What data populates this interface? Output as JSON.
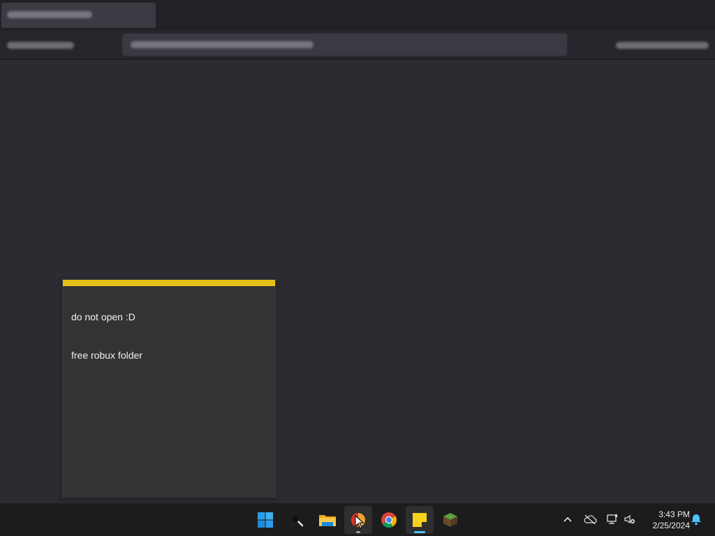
{
  "sticky_note": {
    "lines": [
      "do not open :D",
      "free robux folder"
    ],
    "accent_color": "#e6bf16"
  },
  "taskbar": {
    "items": [
      {
        "name": "start",
        "icon": "windows-logo-icon"
      },
      {
        "name": "search",
        "icon": "search-icon"
      },
      {
        "name": "file-explorer",
        "icon": "folder-icon"
      },
      {
        "name": "app",
        "icon": "app-icon",
        "running": true
      },
      {
        "name": "chrome",
        "icon": "chrome-icon"
      },
      {
        "name": "sticky-notes",
        "icon": "sticky-notes-icon",
        "active": true
      },
      {
        "name": "minecraft",
        "icon": "minecraft-icon"
      }
    ],
    "tray": [
      "chevron-up-icon",
      "cloud-offline-icon",
      "network-icon",
      "volume-muted-icon",
      "notification-bell-icon"
    ]
  },
  "clock": {
    "time": "3:43 PM",
    "date": "2/25/2024"
  }
}
